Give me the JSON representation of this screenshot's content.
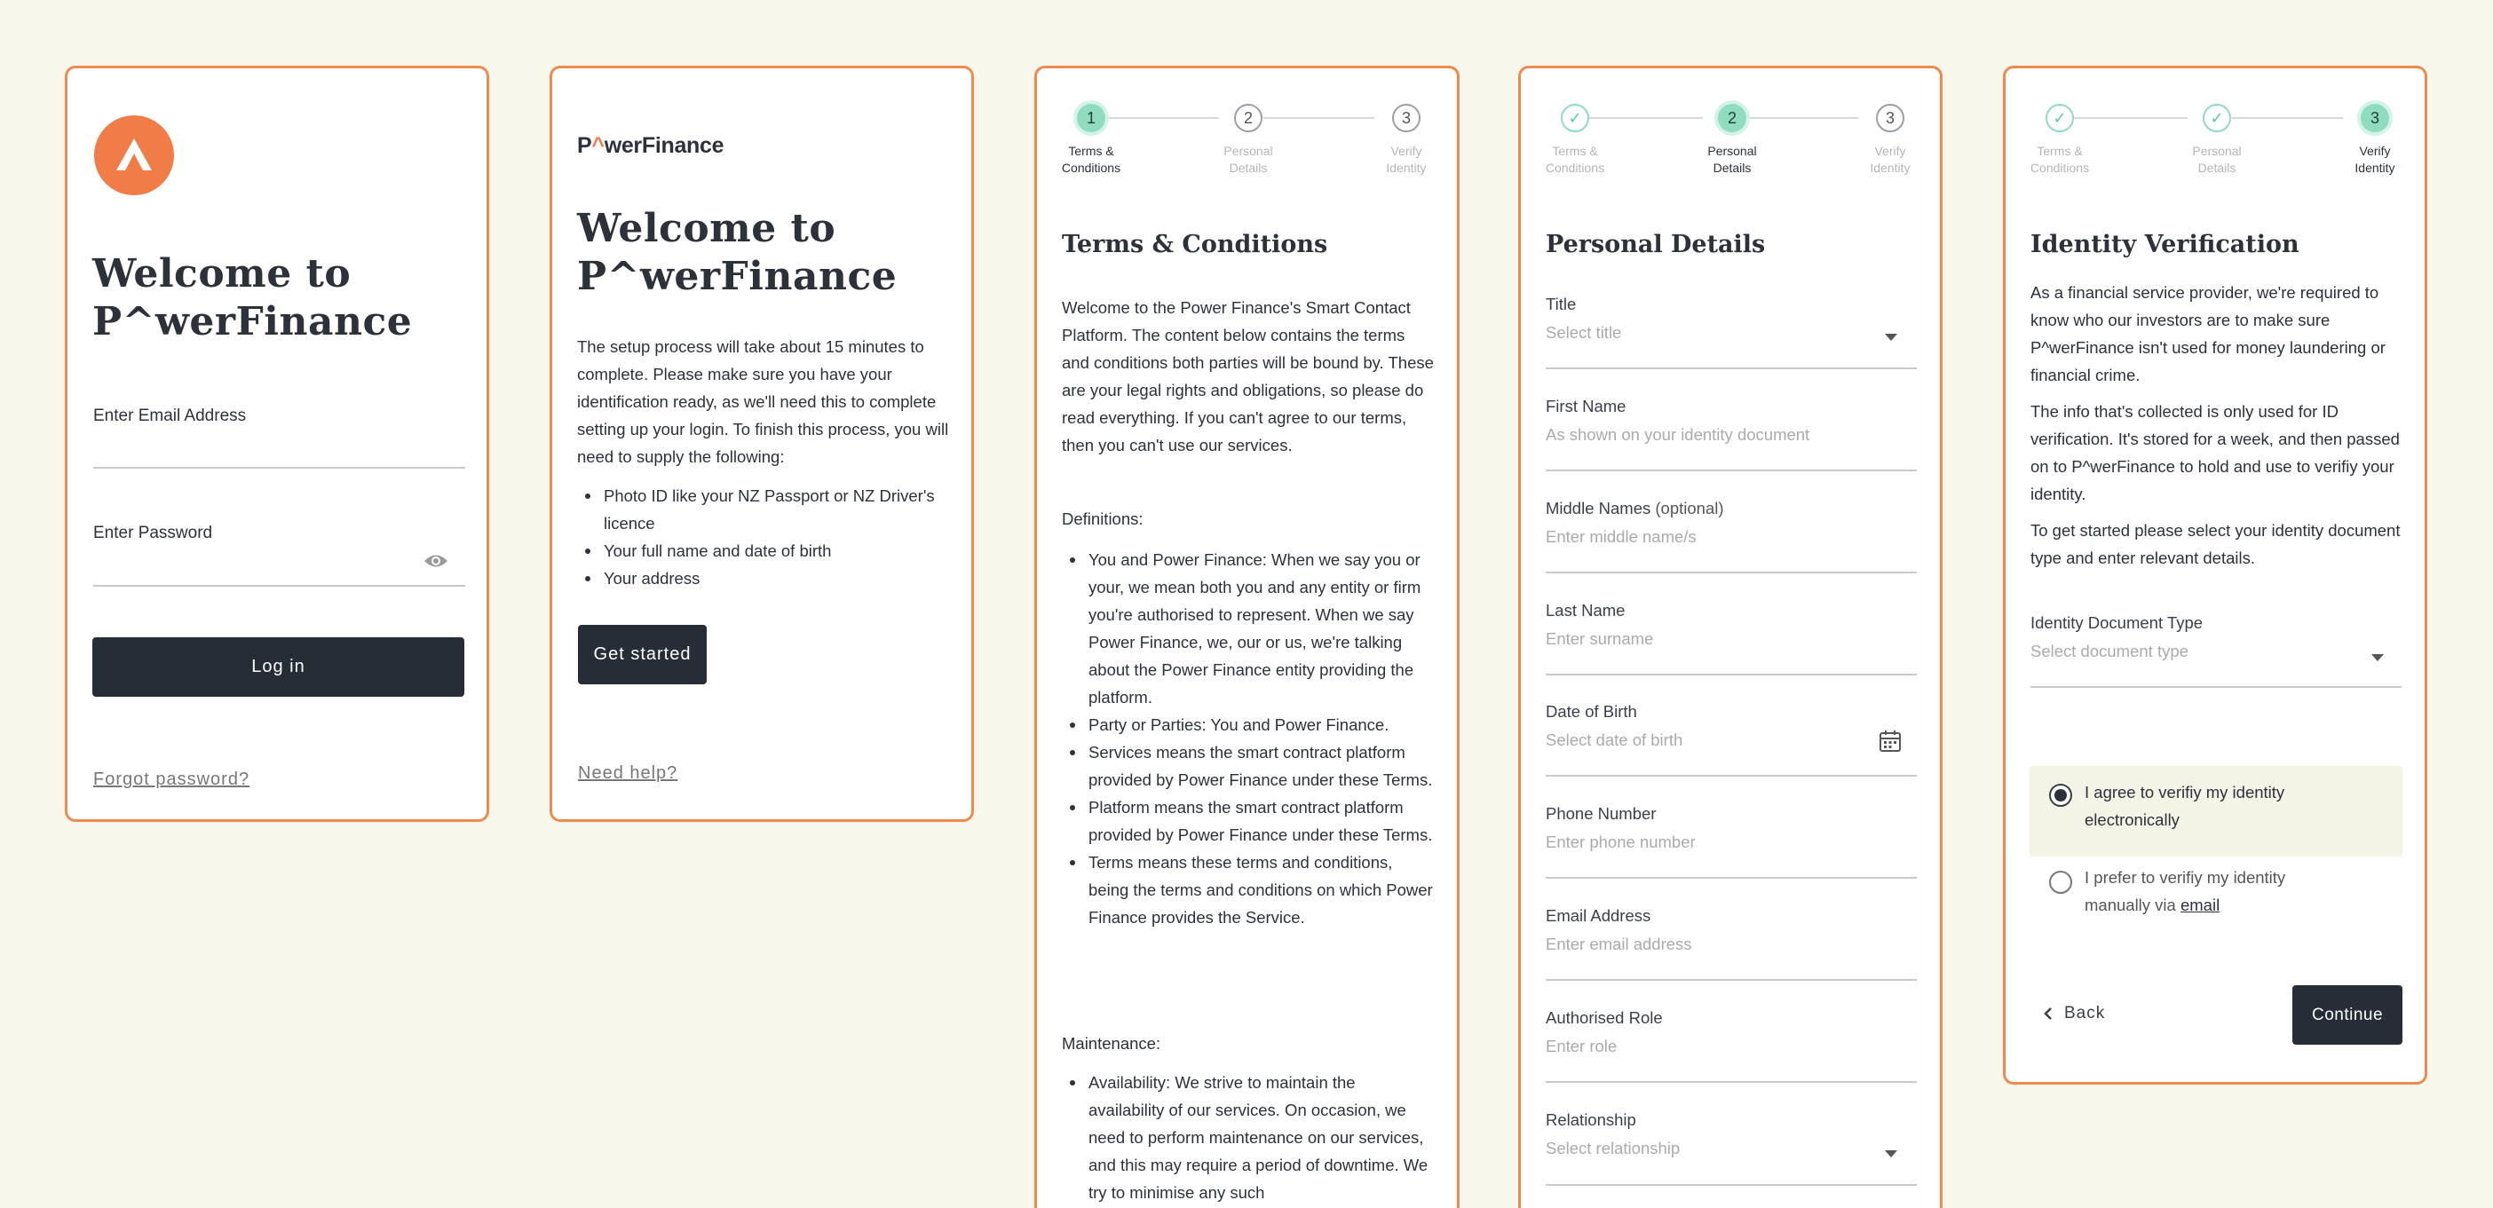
{
  "colors": {
    "background": "#f7f7ec",
    "card_border": "#ee8a4e",
    "accent": "#f07d48",
    "button_dark": "#272d37",
    "step_active": "#8fdcc0"
  },
  "login": {
    "title_line1": "Welcome to",
    "title_line2": "P^werFinance",
    "email_label": "Enter Email Address",
    "password_label": "Enter Password",
    "login_button": "Log in",
    "forgot_link": "Forgot password?"
  },
  "welcome": {
    "brand_p": "P",
    "brand_caret": "^",
    "brand_rest": "werFinance",
    "title_line1": "Welcome to",
    "title_line2": "P^werFinance",
    "intro": "The setup process will take about 15 minutes to complete. Please make sure you have your identification ready, as we'll need this to complete setting up your login. To finish this process, you will need to supply the following:",
    "requirements": [
      "Photo ID like your NZ Passport or NZ Driver's licence",
      "Your full name and date of birth",
      "Your address"
    ],
    "start_button": "Get started",
    "help_link": "Need help?"
  },
  "steps": [
    {
      "number": "1",
      "label_line1": "Terms &",
      "label_line2": "Conditions"
    },
    {
      "number": "2",
      "label_line1": "Personal",
      "label_line2": "Details"
    },
    {
      "number": "3",
      "label_line1": "Verify",
      "label_line2": "Identity"
    }
  ],
  "step_done_mark": "✓",
  "terms": {
    "title": "Terms & Conditions",
    "intro": "Welcome to the Power Finance's Smart Contact Platform. The content below contains the terms and conditions both parties will be bound by. These are your legal rights and obligations, so please do read everything. If you can't agree to our terms, then you can't use our services.",
    "definitions_heading": "Definitions:",
    "definitions": [
      "You and Power Finance: When we say you or your, we mean both you and any entity or firm you're authorised to represent. When we say Power Finance, we, our or us, we're talking about the Power Finance entity providing the platform.",
      "Party or Parties: You and Power Finance.",
      "Services means the smart contract platform provided by Power Finance under these Terms.",
      "Platform means the smart contract platform provided by Power Finance under these Terms.",
      "Terms means these terms and conditions, being the terms and conditions on which Power Finance provides the Service."
    ],
    "maintenance_heading": "Maintenance:",
    "maintenance": [
      "Availability: We strive to maintain the availability of our services. On occasion, we need to perform maintenance on our services, and this may require a period of downtime. We try to minimise any such"
    ]
  },
  "personal": {
    "title": "Personal Details",
    "fields": [
      {
        "label": "Title",
        "placeholder": "Select title"
      },
      {
        "label": "First Name",
        "placeholder": "As shown on your identity document"
      },
      {
        "label": "Middle Names",
        "optional": "(optional)",
        "placeholder": "Enter middle name/s"
      },
      {
        "label": "Last Name",
        "placeholder": "Enter surname"
      },
      {
        "label": "Date of Birth",
        "placeholder": "Select date of birth"
      },
      {
        "label": "Phone Number",
        "placeholder": "Enter phone number"
      },
      {
        "label": "Email Address",
        "placeholder": "Enter email address"
      },
      {
        "label": "Authorised Role",
        "placeholder": "Enter role"
      },
      {
        "label": "Relationship",
        "placeholder": "Select relationship"
      }
    ]
  },
  "identity": {
    "title": "Identity Verification",
    "para1": "As a financial service provider, we're required to know who our investors are to make sure P^werFinance isn't used for money laundering or financial crime.",
    "para2": "The info that's collected is only used for ID verification. It's stored for a week, and then passed on to P^werFinance to hold and use to verifiy your identity.",
    "para3": "To get started please select your identity document type and enter relevant details.",
    "doc_type_label": "Identity Document Type",
    "doc_type_placeholder": "Select document type",
    "option_electronic_line1": "I agree to verifiy my identity",
    "option_electronic_line2": "electronically",
    "option_manual_line1": "I prefer to verifiy my identity",
    "option_manual_line2": "manually via ",
    "option_manual_link": "email",
    "selected_option": "electronic",
    "back_button": "Back",
    "continue_button": "Continue"
  }
}
